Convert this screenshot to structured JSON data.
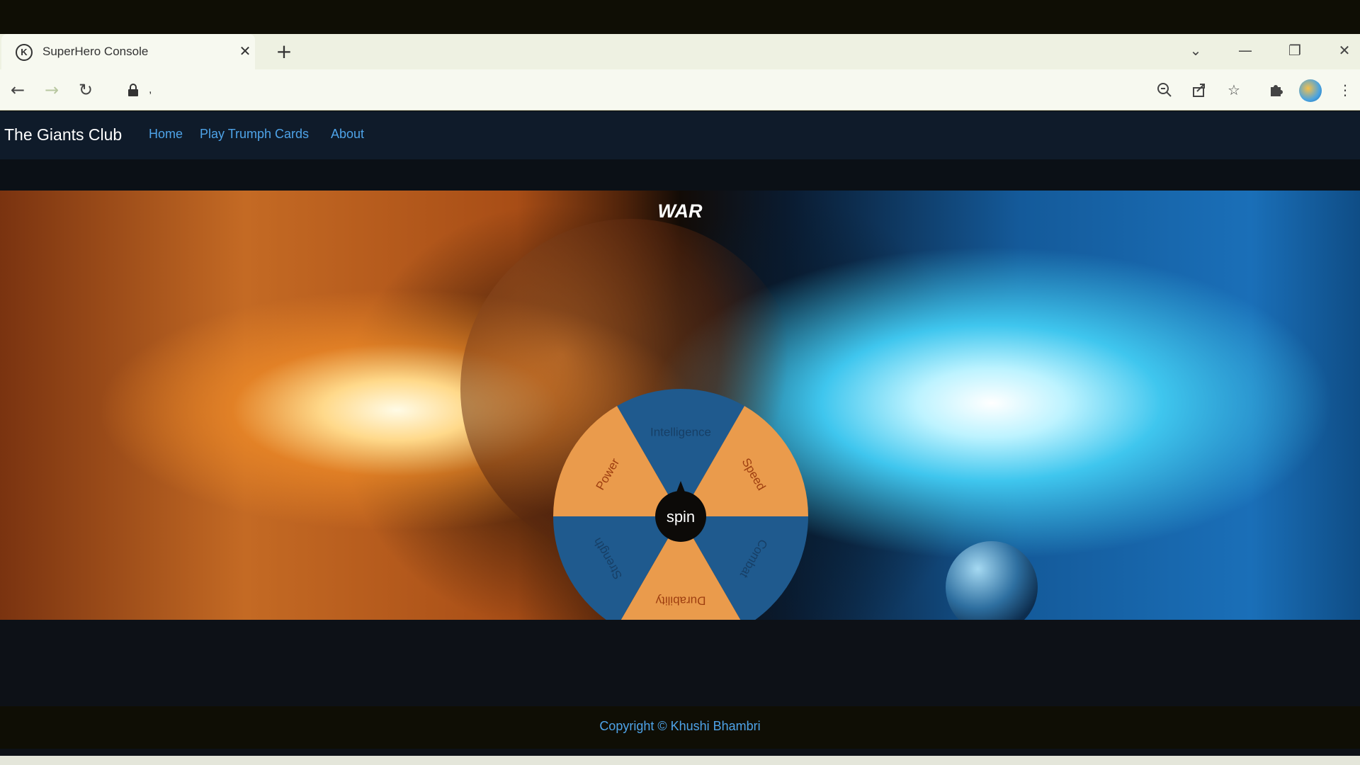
{
  "browser": {
    "tab_title": "SuperHero Console",
    "tab_favicon_letter": "K",
    "url": ","
  },
  "site": {
    "brand": "The Giants Club",
    "nav": [
      "Home",
      "Play Trumph Cards",
      "About"
    ]
  },
  "hero": {
    "title": "WAR",
    "spin_label": "spin",
    "segments": [
      {
        "label": "Intelligence",
        "color": "#1f5a8e"
      },
      {
        "label": "Speed",
        "color": "#ea9b4c"
      },
      {
        "label": "Combat",
        "color": "#1f5a8e"
      },
      {
        "label": "Durability",
        "color": "#ea9b4c"
      },
      {
        "label": "Strength",
        "color": "#1f5a8e"
      },
      {
        "label": "Power",
        "color": "#ea9b4c"
      }
    ]
  },
  "footer": {
    "copyright": "Copyright © Khushi Bhambri"
  }
}
